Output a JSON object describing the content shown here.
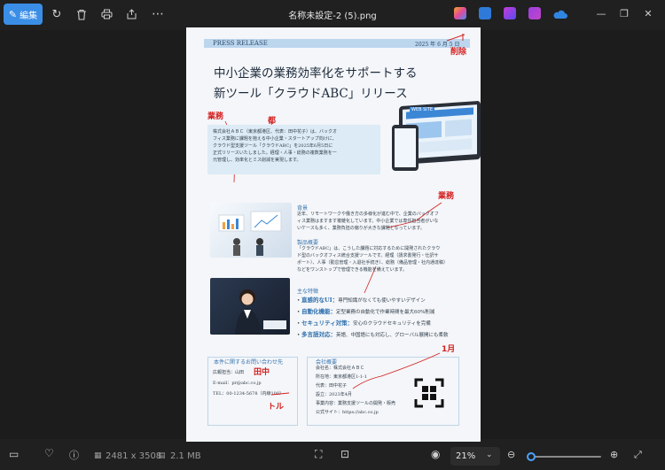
{
  "toolbar": {
    "edit_label": "編集",
    "window_title": "名称未設定-2 (5).png"
  },
  "icons": [
    "pencil-icon",
    "rotate-icon",
    "trash-icon",
    "print-icon",
    "share-icon",
    "more-icon"
  ],
  "bottom": {
    "dimensions": "2481 x 3508",
    "filesize": "2.1 MB",
    "zoom": "21%",
    "zoom_fraction": 0.04
  },
  "document": {
    "pr_label": "PRESS RELEASE",
    "pr_date": "2025 年 6 月 5 日",
    "headline_1": "中小企業の業務効率化をサポートする",
    "headline_2": "新ツール「クラウドABC」リリース",
    "lead": [
      "株式会社ＡＢＣ（東京都港区、代表：田中花子）は、バックオ",
      "フィス業務に課題を抱える中小企業・スタートアップ向けに、",
      "クラウド型支援ツール「クラウドABC」を2025年6月5日に",
      "正式リリースいたしました。経理・人事・総務の複数業務を一",
      "元管理し、効率化とミス削減を実現します。"
    ],
    "background_title": "背景",
    "background": [
      "近年、リモートワークや働き方の多様化が進む中で、企業のバックオフ",
      "ィス業務はますます複雑化しています。中小企業では専任担当者がいな",
      "いケースも多く、業務負担の偏りが大きな課題となっています。"
    ],
    "overview_title": "製品概要",
    "overview": [
      "「クラウドABC」は、こうした課題に対応するために開発されたクラウ",
      "ド型のバックオフィス統合支援ツールです。経理（請求書発行・仕訳サ",
      "ポート）、人事（勤怠管理・入退社手続き）、総務（備品管理・社内通達稿）",
      "などをワンストップで管理できる機能を備えています。"
    ],
    "features_title": "主な特徴",
    "features": [
      {
        "head": "直感的なUI：",
        "text": "専門知識がなくても使いやすいデザイン"
      },
      {
        "head": "自動化機能：",
        "text": "定型業務の自動化で作業時間を最大60%削減"
      },
      {
        "head": "セキュリティ対策：",
        "text": "安心のクラウドセキュリティを完備"
      },
      {
        "head": "多言語対応：",
        "text": "英語、中国語にも対応し、グローバル展開にも柔軟"
      }
    ],
    "contact_title": "本件に関するお問い合わせ先",
    "contact": [
      "広報担当：山田",
      "E-mail：pr@abc.co.jp",
      "TEL：00-1234-5678（内線100）"
    ],
    "company_title": "会社概要",
    "company": [
      "会社名：株式会社ＡＢＣ",
      "所在地：東京都港区1-1-1",
      "代表：田中花子",
      "設立：2023年4月",
      "事業内容：業務支援ツールの開発・販売",
      "公式サイト：https://abc.co.jp"
    ],
    "website_label": "WEB SITE"
  },
  "annotations": {
    "delete": "削除",
    "gyomu1": "業務",
    "to": "都",
    "gyomu2": "業務",
    "tanaka": "田中",
    "toru": "トル",
    "ichigatsu": "1月"
  }
}
